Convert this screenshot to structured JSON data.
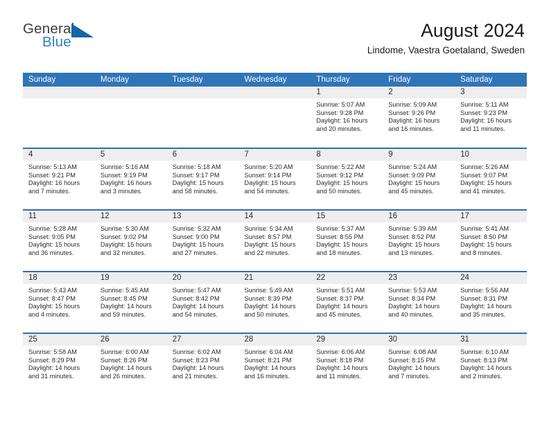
{
  "logo": {
    "word_top": "General",
    "word_bottom": "Blue",
    "accent_color": "#2f7fc1",
    "triangle_color": "#1565a8",
    "triangle_icon": "triangle-icon"
  },
  "header": {
    "title": "August 2024",
    "subtitle": "Lindome, Vaestra Goetaland, Sweden"
  },
  "theme": {
    "header_blue": "#3075b8",
    "separator_blue": "#2f6fb0",
    "daynum_band": "#eeeeee"
  },
  "calendar": {
    "weekday_headers": [
      "Sunday",
      "Monday",
      "Tuesday",
      "Wednesday",
      "Thursday",
      "Friday",
      "Saturday"
    ],
    "weeks": [
      [
        {
          "day": "",
          "lines": []
        },
        {
          "day": "",
          "lines": []
        },
        {
          "day": "",
          "lines": []
        },
        {
          "day": "",
          "lines": []
        },
        {
          "day": "1",
          "lines": [
            "Sunrise: 5:07 AM",
            "Sunset: 9:28 PM",
            "Daylight: 16 hours",
            "and 20 minutes."
          ]
        },
        {
          "day": "2",
          "lines": [
            "Sunrise: 5:09 AM",
            "Sunset: 9:26 PM",
            "Daylight: 16 hours",
            "and 16 minutes."
          ]
        },
        {
          "day": "3",
          "lines": [
            "Sunrise: 5:11 AM",
            "Sunset: 9:23 PM",
            "Daylight: 16 hours",
            "and 11 minutes."
          ]
        }
      ],
      [
        {
          "day": "4",
          "lines": [
            "Sunrise: 5:13 AM",
            "Sunset: 9:21 PM",
            "Daylight: 16 hours",
            "and 7 minutes."
          ]
        },
        {
          "day": "5",
          "lines": [
            "Sunrise: 5:16 AM",
            "Sunset: 9:19 PM",
            "Daylight: 16 hours",
            "and 3 minutes."
          ]
        },
        {
          "day": "6",
          "lines": [
            "Sunrise: 5:18 AM",
            "Sunset: 9:17 PM",
            "Daylight: 15 hours",
            "and 58 minutes."
          ]
        },
        {
          "day": "7",
          "lines": [
            "Sunrise: 5:20 AM",
            "Sunset: 9:14 PM",
            "Daylight: 15 hours",
            "and 54 minutes."
          ]
        },
        {
          "day": "8",
          "lines": [
            "Sunrise: 5:22 AM",
            "Sunset: 9:12 PM",
            "Daylight: 15 hours",
            "and 50 minutes."
          ]
        },
        {
          "day": "9",
          "lines": [
            "Sunrise: 5:24 AM",
            "Sunset: 9:09 PM",
            "Daylight: 15 hours",
            "and 45 minutes."
          ]
        },
        {
          "day": "10",
          "lines": [
            "Sunrise: 5:26 AM",
            "Sunset: 9:07 PM",
            "Daylight: 15 hours",
            "and 41 minutes."
          ]
        }
      ],
      [
        {
          "day": "11",
          "lines": [
            "Sunrise: 5:28 AM",
            "Sunset: 9:05 PM",
            "Daylight: 15 hours",
            "and 36 minutes."
          ]
        },
        {
          "day": "12",
          "lines": [
            "Sunrise: 5:30 AM",
            "Sunset: 9:02 PM",
            "Daylight: 15 hours",
            "and 32 minutes."
          ]
        },
        {
          "day": "13",
          "lines": [
            "Sunrise: 5:32 AM",
            "Sunset: 9:00 PM",
            "Daylight: 15 hours",
            "and 27 minutes."
          ]
        },
        {
          "day": "14",
          "lines": [
            "Sunrise: 5:34 AM",
            "Sunset: 8:57 PM",
            "Daylight: 15 hours",
            "and 22 minutes."
          ]
        },
        {
          "day": "15",
          "lines": [
            "Sunrise: 5:37 AM",
            "Sunset: 8:55 PM",
            "Daylight: 15 hours",
            "and 18 minutes."
          ]
        },
        {
          "day": "16",
          "lines": [
            "Sunrise: 5:39 AM",
            "Sunset: 8:52 PM",
            "Daylight: 15 hours",
            "and 13 minutes."
          ]
        },
        {
          "day": "17",
          "lines": [
            "Sunrise: 5:41 AM",
            "Sunset: 8:50 PM",
            "Daylight: 15 hours",
            "and 8 minutes."
          ]
        }
      ],
      [
        {
          "day": "18",
          "lines": [
            "Sunrise: 5:43 AM",
            "Sunset: 8:47 PM",
            "Daylight: 15 hours",
            "and 4 minutes."
          ]
        },
        {
          "day": "19",
          "lines": [
            "Sunrise: 5:45 AM",
            "Sunset: 8:45 PM",
            "Daylight: 14 hours",
            "and 59 minutes."
          ]
        },
        {
          "day": "20",
          "lines": [
            "Sunrise: 5:47 AM",
            "Sunset: 8:42 PM",
            "Daylight: 14 hours",
            "and 54 minutes."
          ]
        },
        {
          "day": "21",
          "lines": [
            "Sunrise: 5:49 AM",
            "Sunset: 8:39 PM",
            "Daylight: 14 hours",
            "and 50 minutes."
          ]
        },
        {
          "day": "22",
          "lines": [
            "Sunrise: 5:51 AM",
            "Sunset: 8:37 PM",
            "Daylight: 14 hours",
            "and 45 minutes."
          ]
        },
        {
          "day": "23",
          "lines": [
            "Sunrise: 5:53 AM",
            "Sunset: 8:34 PM",
            "Daylight: 14 hours",
            "and 40 minutes."
          ]
        },
        {
          "day": "24",
          "lines": [
            "Sunrise: 5:56 AM",
            "Sunset: 8:31 PM",
            "Daylight: 14 hours",
            "and 35 minutes."
          ]
        }
      ],
      [
        {
          "day": "25",
          "lines": [
            "Sunrise: 5:58 AM",
            "Sunset: 8:29 PM",
            "Daylight: 14 hours",
            "and 31 minutes."
          ]
        },
        {
          "day": "26",
          "lines": [
            "Sunrise: 6:00 AM",
            "Sunset: 8:26 PM",
            "Daylight: 14 hours",
            "and 26 minutes."
          ]
        },
        {
          "day": "27",
          "lines": [
            "Sunrise: 6:02 AM",
            "Sunset: 8:23 PM",
            "Daylight: 14 hours",
            "and 21 minutes."
          ]
        },
        {
          "day": "28",
          "lines": [
            "Sunrise: 6:04 AM",
            "Sunset: 8:21 PM",
            "Daylight: 14 hours",
            "and 16 minutes."
          ]
        },
        {
          "day": "29",
          "lines": [
            "Sunrise: 6:06 AM",
            "Sunset: 8:18 PM",
            "Daylight: 14 hours",
            "and 11 minutes."
          ]
        },
        {
          "day": "30",
          "lines": [
            "Sunrise: 6:08 AM",
            "Sunset: 8:15 PM",
            "Daylight: 14 hours",
            "and 7 minutes."
          ]
        },
        {
          "day": "31",
          "lines": [
            "Sunrise: 6:10 AM",
            "Sunset: 8:13 PM",
            "Daylight: 14 hours",
            "and 2 minutes."
          ]
        }
      ]
    ]
  }
}
